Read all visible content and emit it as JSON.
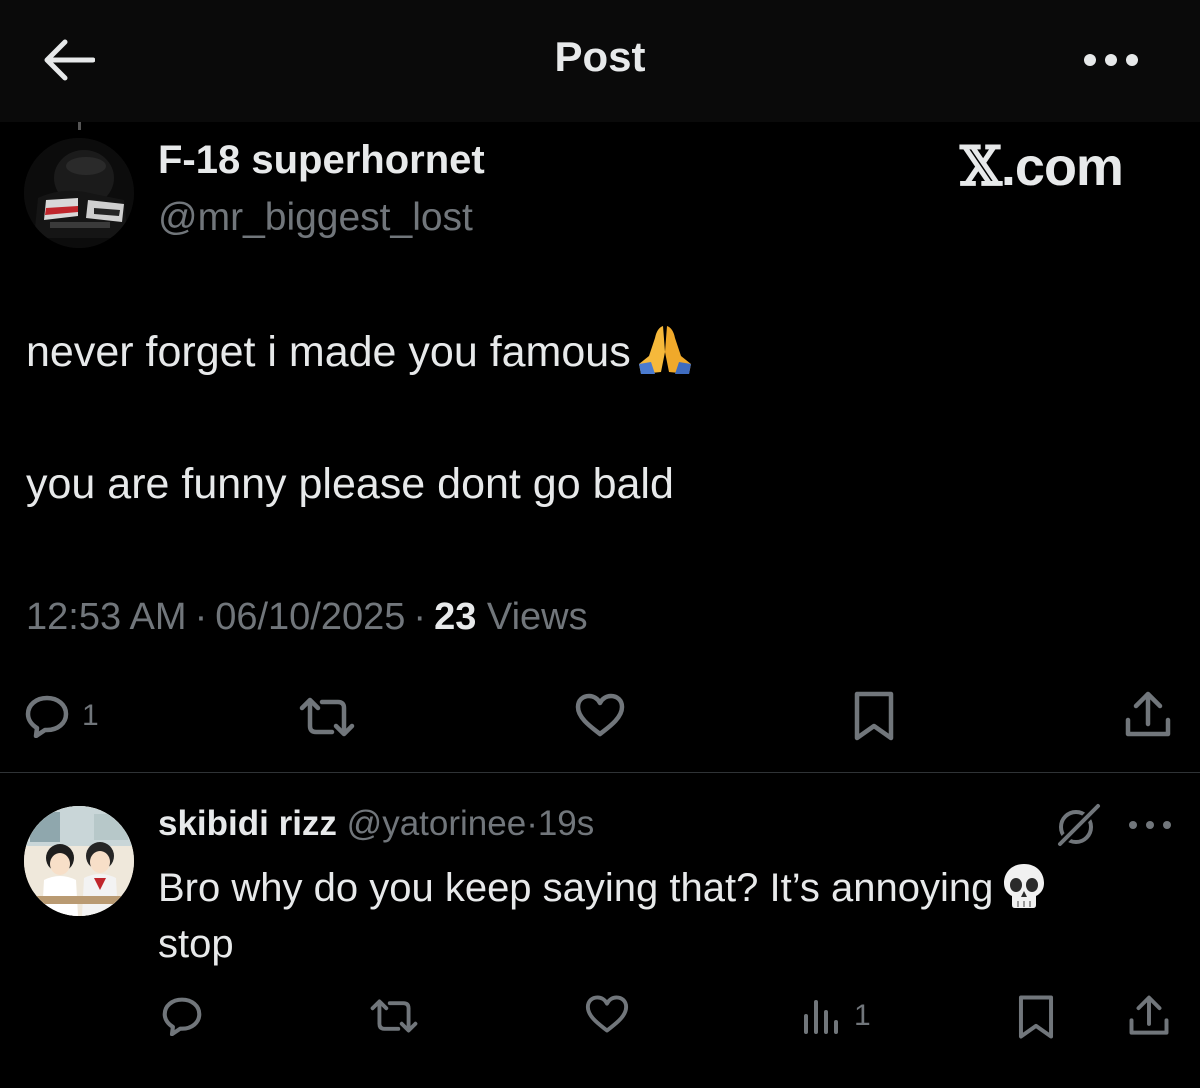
{
  "header": {
    "title": "Post",
    "back_icon": "arrow-left-icon",
    "more_icon": "ellipsis-icon"
  },
  "post": {
    "author_name": "F-18 superhornet",
    "author_handle": "@mr_biggest_lost",
    "brand": "X.com",
    "body_line_1": "never forget i made you famous",
    "body_emoji": "folded-hands-emoji",
    "body_line_2": "you are funny please dont go bald",
    "time": "12:53 AM",
    "date": "06/10/2025",
    "views_count": "23",
    "views_label": "Views",
    "separator": "·",
    "actions": {
      "reply_count": "1",
      "reply_icon": "reply-icon",
      "repost_icon": "repost-icon",
      "like_icon": "heart-icon",
      "bookmark_icon": "bookmark-icon",
      "share_icon": "share-icon"
    }
  },
  "reply": {
    "author_name": "skibidi rizz",
    "author_handle": "@yatorinee",
    "separator": "·",
    "time": "19s",
    "text": "Bro why do you keep saying that? It’s annoying",
    "text_emoji": "skull-emoji",
    "text_tail": "stop",
    "grok_icon": "grok-icon",
    "actions": {
      "views_count": "1",
      "reply_icon": "reply-icon",
      "repost_icon": "repost-icon",
      "like_icon": "heart-icon",
      "views_icon": "analytics-icon",
      "bookmark_icon": "bookmark-icon",
      "share_icon": "share-icon"
    }
  },
  "colors": {
    "background": "#000000",
    "header_background": "#0a0a0a",
    "primary_text": "#e7e9ea",
    "secondary_text": "#71767b",
    "divider": "#2f3336"
  }
}
